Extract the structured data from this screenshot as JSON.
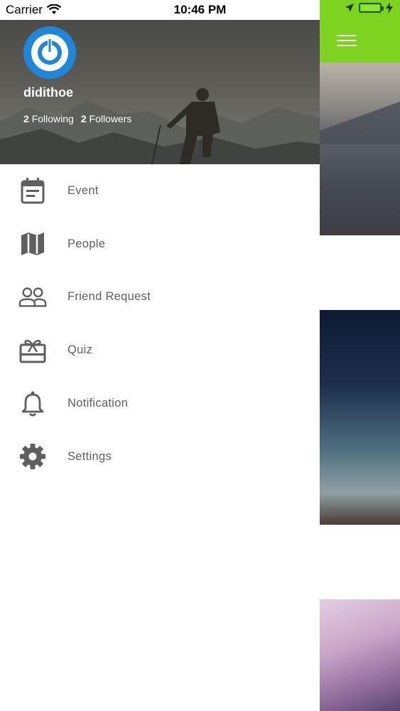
{
  "status_bar": {
    "carrier": "Carrier",
    "time": "10:46 PM",
    "icons": [
      "wifi-icon",
      "location-arrow-icon",
      "battery-icon",
      "charging-bolt-icon"
    ]
  },
  "colors": {
    "accent_green": "#7ed321",
    "avatar_blue": "#1f86d8",
    "menu_text": "#5f5f5f",
    "menu_icon": "#5f5f5f"
  },
  "drawer": {
    "profile": {
      "username": "didithoe",
      "following_count": "2",
      "following_label": "Following",
      "followers_count": "2",
      "followers_label": "Followers"
    },
    "menu": [
      {
        "label": "Event",
        "icon": "calendar-icon"
      },
      {
        "label": "People",
        "icon": "map-icon"
      },
      {
        "label": "Friend Request",
        "icon": "people-icon"
      },
      {
        "label": "Quiz",
        "icon": "gift-card-icon"
      },
      {
        "label": "Notification",
        "icon": "bell-icon"
      },
      {
        "label": "Settings",
        "icon": "gear-icon"
      }
    ]
  },
  "main": {
    "menu_icon": "hamburger-menu-icon"
  }
}
